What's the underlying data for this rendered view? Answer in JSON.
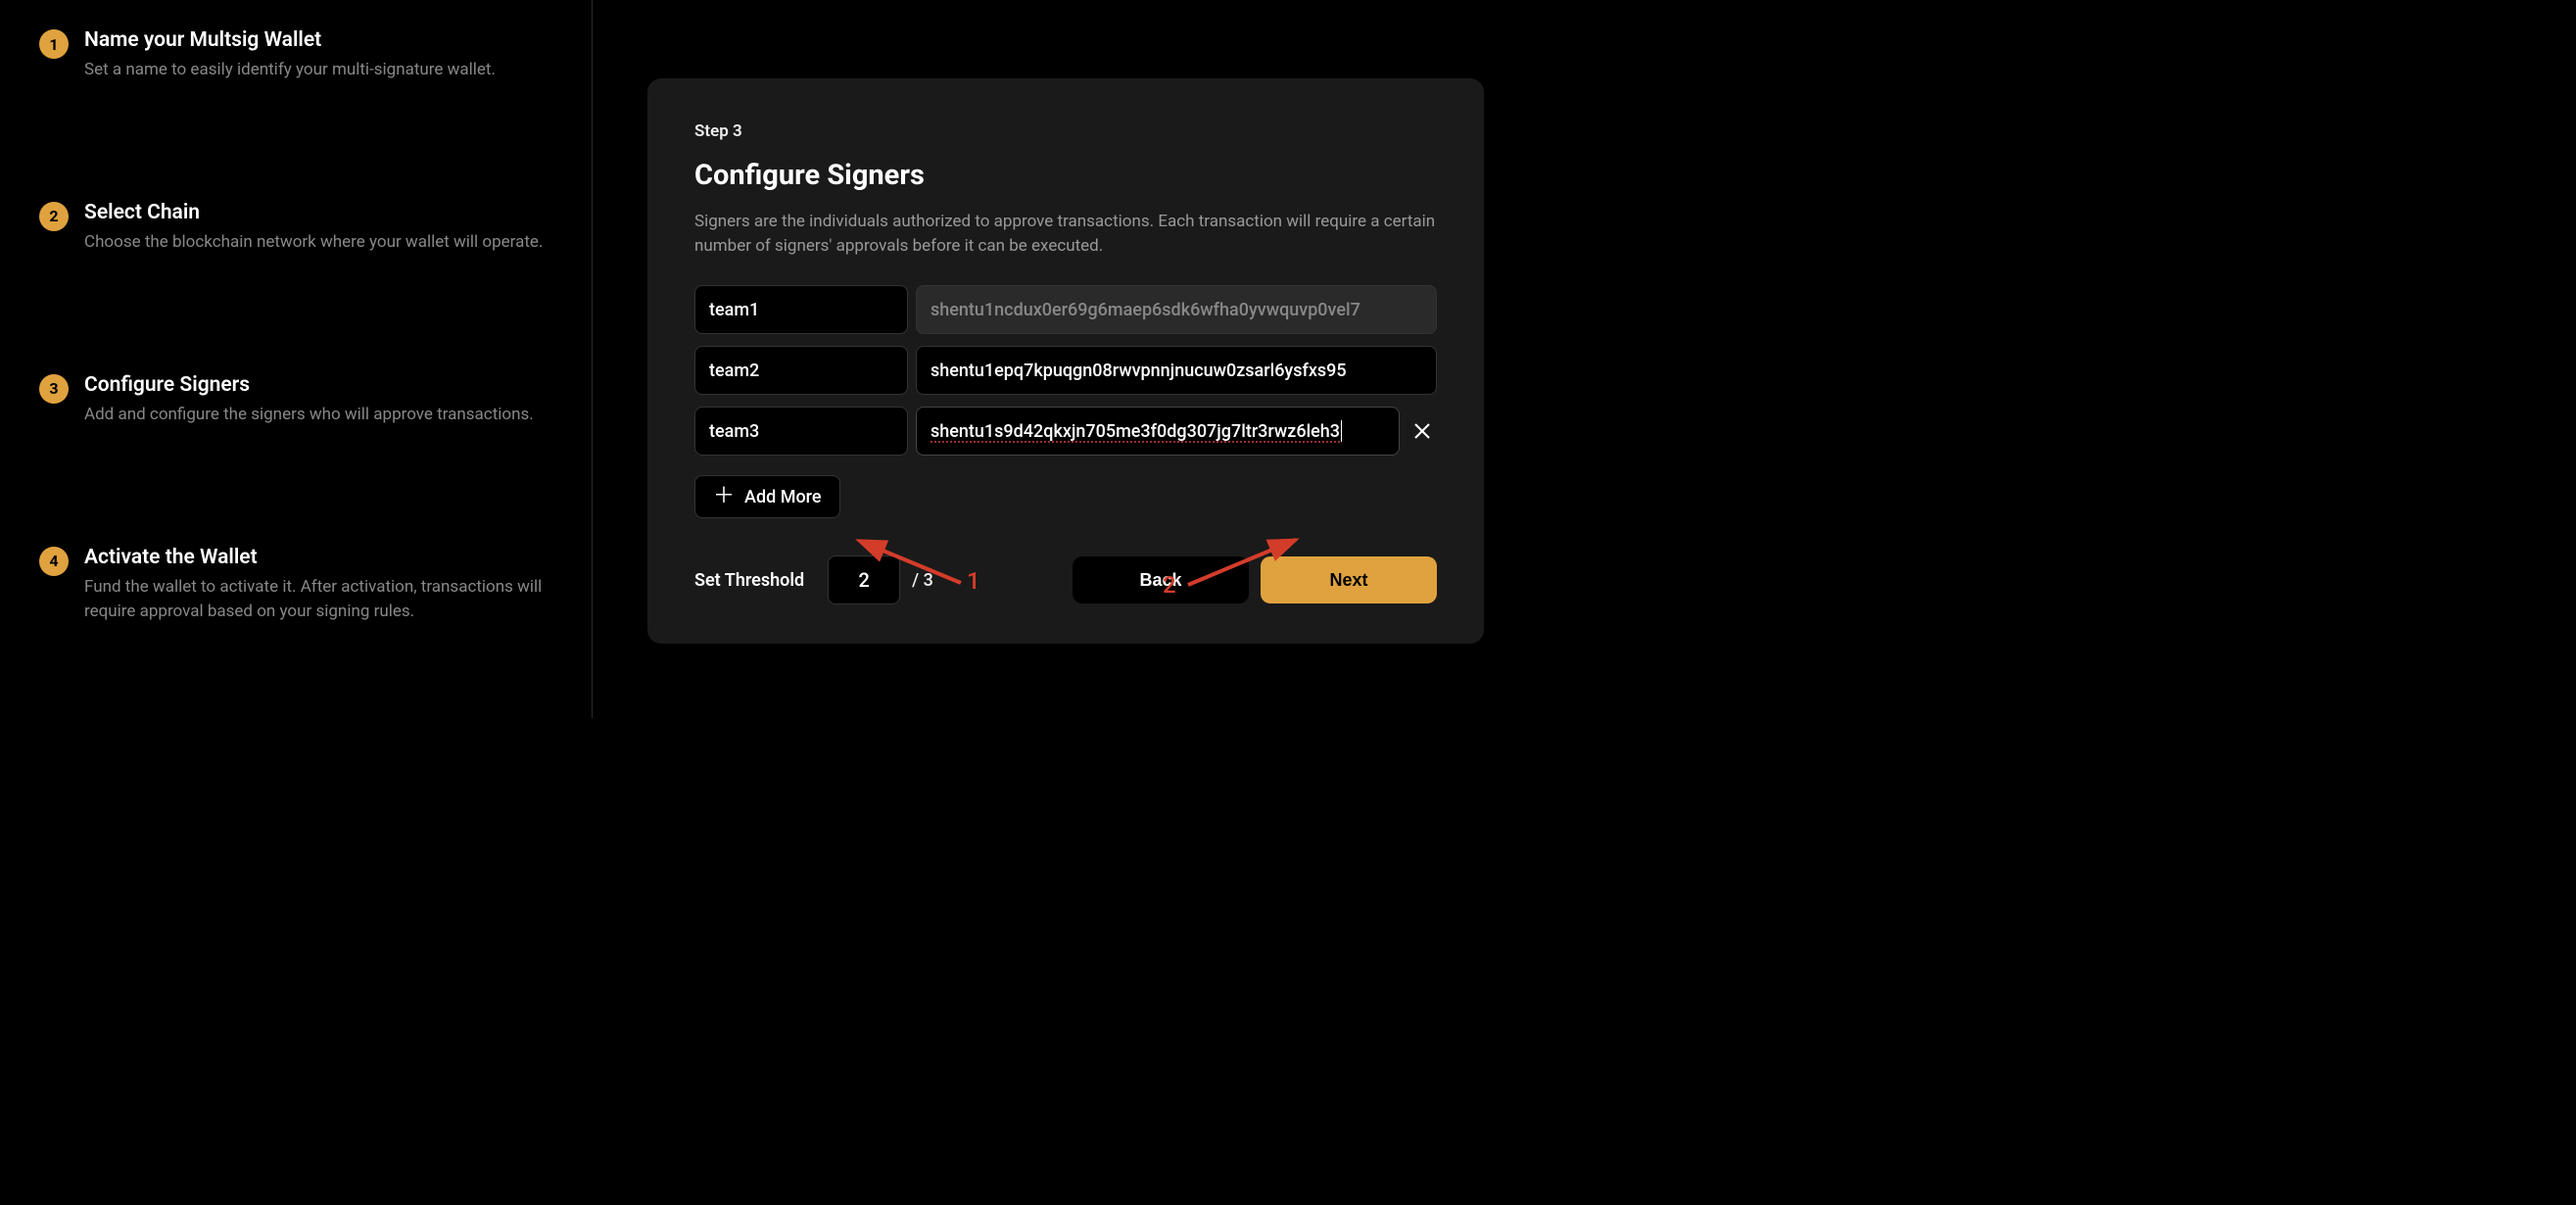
{
  "stepper": {
    "steps": [
      {
        "num": "1",
        "title": "Name your Multsig Wallet",
        "desc": "Set a name to easily identify your multi-signature wallet."
      },
      {
        "num": "2",
        "title": "Select Chain",
        "desc": "Choose the blockchain network where your wallet will operate."
      },
      {
        "num": "3",
        "title": "Configure Signers",
        "desc": "Add and configure the signers who will approve transactions."
      },
      {
        "num": "4",
        "title": "Activate the Wallet",
        "desc": "Fund the wallet to activate it. After activation, transactions will require approval based on your signing rules."
      }
    ]
  },
  "main": {
    "step_label": "Step 3",
    "title": "Configure Signers",
    "description": "Signers are the individuals authorized to approve transactions. Each transaction will require a certain number of signers' approvals before it can be executed.",
    "signers": [
      {
        "name": "team1",
        "address": "shentu1ncdux0er69g6maep6sdk6wfha0yvwquvp0vel7",
        "readonly": true
      },
      {
        "name": "team2",
        "address": "shentu1epq7kpuqgn08rwvpnnjnucuw0zsarl6ysfxs95",
        "readonly": false
      },
      {
        "name": "team3",
        "address": "shentu1s9d42qkxjn705me3f0dg307jg7ltr3rwz6leh3",
        "readonly": false,
        "focused": true,
        "removable": true
      }
    ],
    "add_more_label": "Add More",
    "threshold": {
      "label": "Set Threshold",
      "value": "2",
      "total": "/ 3"
    },
    "back_label": "Back",
    "next_label": "Next"
  },
  "annotations": {
    "arrow1_label": "1",
    "arrow2_label": "2"
  }
}
